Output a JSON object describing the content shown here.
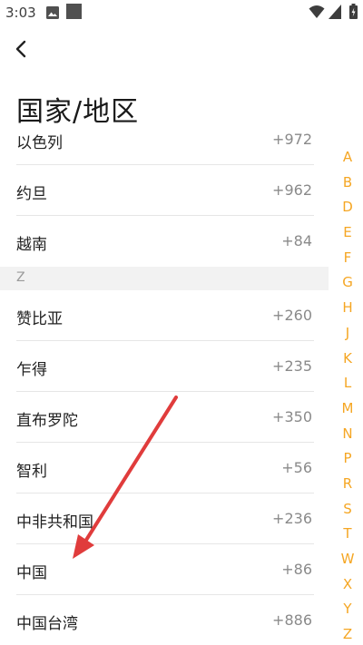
{
  "status_bar": {
    "time": "3:03",
    "icons": [
      "photo-icon",
      "square-icon",
      "wifi-icon",
      "signal-icon",
      "battery-icon"
    ]
  },
  "header": {
    "back_icon": "chevron-left-icon",
    "title": "国家/地区"
  },
  "list": {
    "rows_before": [
      {
        "name": "以色列",
        "code": "+972"
      },
      {
        "name": "约旦",
        "code": "+962"
      },
      {
        "name": "越南",
        "code": "+84"
      }
    ],
    "section_letter": "Z",
    "rows_after": [
      {
        "name": "赞比亚",
        "code": "+260"
      },
      {
        "name": "乍得",
        "code": "+235"
      },
      {
        "name": "直布罗陀",
        "code": "+350"
      },
      {
        "name": "智利",
        "code": "+56"
      },
      {
        "name": "中非共和国",
        "code": "+236"
      },
      {
        "name": "中国",
        "code": "+86"
      },
      {
        "name": "中国台湾",
        "code": "+886"
      }
    ]
  },
  "alpha_index": [
    "A",
    "B",
    "D",
    "E",
    "F",
    "G",
    "H",
    "J",
    "K",
    "L",
    "M",
    "N",
    "P",
    "R",
    "S",
    "T",
    "W",
    "X",
    "Y",
    "Z"
  ],
  "colors": {
    "accent": "#f5a623",
    "annotation_arrow": "#e03c3c"
  }
}
